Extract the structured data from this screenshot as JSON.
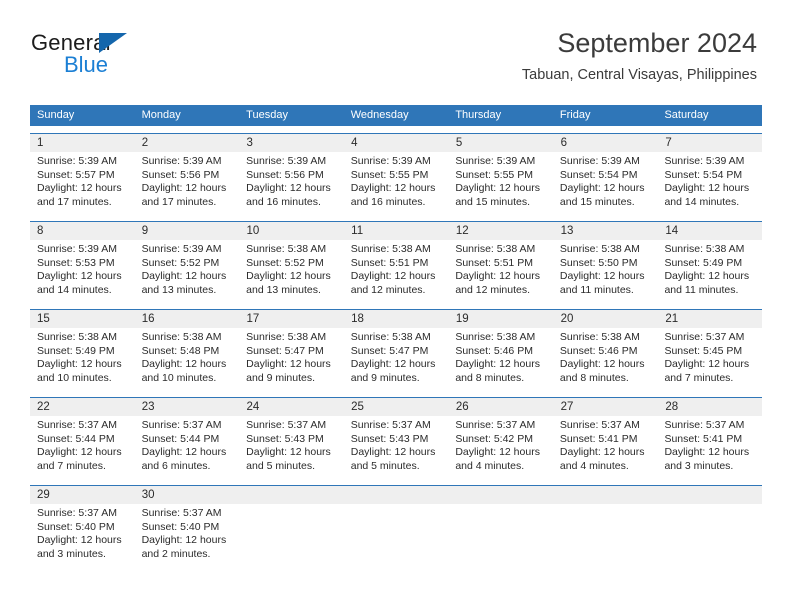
{
  "brand": {
    "name_dark": "General",
    "name_light": "Blue",
    "triangle_color": "#1466ac",
    "light_color": "#1b7fd4"
  },
  "header": {
    "title": "September 2024",
    "subtitle": "Tabuan, Central Visayas, Philippines"
  },
  "theme": {
    "header_bg": "#2f76b8",
    "row_border": "#2f76b8",
    "daynum_bg": "#efefef",
    "text": "#2b2b2b"
  },
  "weekdays": [
    "Sunday",
    "Monday",
    "Tuesday",
    "Wednesday",
    "Thursday",
    "Friday",
    "Saturday"
  ],
  "weeks": [
    {
      "days": [
        {
          "num": "1",
          "sunrise": "Sunrise: 5:39 AM",
          "sunset": "Sunset: 5:57 PM",
          "daylight1": "Daylight: 12 hours",
          "daylight2": "and 17 minutes."
        },
        {
          "num": "2",
          "sunrise": "Sunrise: 5:39 AM",
          "sunset": "Sunset: 5:56 PM",
          "daylight1": "Daylight: 12 hours",
          "daylight2": "and 17 minutes."
        },
        {
          "num": "3",
          "sunrise": "Sunrise: 5:39 AM",
          "sunset": "Sunset: 5:56 PM",
          "daylight1": "Daylight: 12 hours",
          "daylight2": "and 16 minutes."
        },
        {
          "num": "4",
          "sunrise": "Sunrise: 5:39 AM",
          "sunset": "Sunset: 5:55 PM",
          "daylight1": "Daylight: 12 hours",
          "daylight2": "and 16 minutes."
        },
        {
          "num": "5",
          "sunrise": "Sunrise: 5:39 AM",
          "sunset": "Sunset: 5:55 PM",
          "daylight1": "Daylight: 12 hours",
          "daylight2": "and 15 minutes."
        },
        {
          "num": "6",
          "sunrise": "Sunrise: 5:39 AM",
          "sunset": "Sunset: 5:54 PM",
          "daylight1": "Daylight: 12 hours",
          "daylight2": "and 15 minutes."
        },
        {
          "num": "7",
          "sunrise": "Sunrise: 5:39 AM",
          "sunset": "Sunset: 5:54 PM",
          "daylight1": "Daylight: 12 hours",
          "daylight2": "and 14 minutes."
        }
      ]
    },
    {
      "days": [
        {
          "num": "8",
          "sunrise": "Sunrise: 5:39 AM",
          "sunset": "Sunset: 5:53 PM",
          "daylight1": "Daylight: 12 hours",
          "daylight2": "and 14 minutes."
        },
        {
          "num": "9",
          "sunrise": "Sunrise: 5:39 AM",
          "sunset": "Sunset: 5:52 PM",
          "daylight1": "Daylight: 12 hours",
          "daylight2": "and 13 minutes."
        },
        {
          "num": "10",
          "sunrise": "Sunrise: 5:38 AM",
          "sunset": "Sunset: 5:52 PM",
          "daylight1": "Daylight: 12 hours",
          "daylight2": "and 13 minutes."
        },
        {
          "num": "11",
          "sunrise": "Sunrise: 5:38 AM",
          "sunset": "Sunset: 5:51 PM",
          "daylight1": "Daylight: 12 hours",
          "daylight2": "and 12 minutes."
        },
        {
          "num": "12",
          "sunrise": "Sunrise: 5:38 AM",
          "sunset": "Sunset: 5:51 PM",
          "daylight1": "Daylight: 12 hours",
          "daylight2": "and 12 minutes."
        },
        {
          "num": "13",
          "sunrise": "Sunrise: 5:38 AM",
          "sunset": "Sunset: 5:50 PM",
          "daylight1": "Daylight: 12 hours",
          "daylight2": "and 11 minutes."
        },
        {
          "num": "14",
          "sunrise": "Sunrise: 5:38 AM",
          "sunset": "Sunset: 5:49 PM",
          "daylight1": "Daylight: 12 hours",
          "daylight2": "and 11 minutes."
        }
      ]
    },
    {
      "days": [
        {
          "num": "15",
          "sunrise": "Sunrise: 5:38 AM",
          "sunset": "Sunset: 5:49 PM",
          "daylight1": "Daylight: 12 hours",
          "daylight2": "and 10 minutes."
        },
        {
          "num": "16",
          "sunrise": "Sunrise: 5:38 AM",
          "sunset": "Sunset: 5:48 PM",
          "daylight1": "Daylight: 12 hours",
          "daylight2": "and 10 minutes."
        },
        {
          "num": "17",
          "sunrise": "Sunrise: 5:38 AM",
          "sunset": "Sunset: 5:47 PM",
          "daylight1": "Daylight: 12 hours",
          "daylight2": "and 9 minutes."
        },
        {
          "num": "18",
          "sunrise": "Sunrise: 5:38 AM",
          "sunset": "Sunset: 5:47 PM",
          "daylight1": "Daylight: 12 hours",
          "daylight2": "and 9 minutes."
        },
        {
          "num": "19",
          "sunrise": "Sunrise: 5:38 AM",
          "sunset": "Sunset: 5:46 PM",
          "daylight1": "Daylight: 12 hours",
          "daylight2": "and 8 minutes."
        },
        {
          "num": "20",
          "sunrise": "Sunrise: 5:38 AM",
          "sunset": "Sunset: 5:46 PM",
          "daylight1": "Daylight: 12 hours",
          "daylight2": "and 8 minutes."
        },
        {
          "num": "21",
          "sunrise": "Sunrise: 5:37 AM",
          "sunset": "Sunset: 5:45 PM",
          "daylight1": "Daylight: 12 hours",
          "daylight2": "and 7 minutes."
        }
      ]
    },
    {
      "days": [
        {
          "num": "22",
          "sunrise": "Sunrise: 5:37 AM",
          "sunset": "Sunset: 5:44 PM",
          "daylight1": "Daylight: 12 hours",
          "daylight2": "and 7 minutes."
        },
        {
          "num": "23",
          "sunrise": "Sunrise: 5:37 AM",
          "sunset": "Sunset: 5:44 PM",
          "daylight1": "Daylight: 12 hours",
          "daylight2": "and 6 minutes."
        },
        {
          "num": "24",
          "sunrise": "Sunrise: 5:37 AM",
          "sunset": "Sunset: 5:43 PM",
          "daylight1": "Daylight: 12 hours",
          "daylight2": "and 5 minutes."
        },
        {
          "num": "25",
          "sunrise": "Sunrise: 5:37 AM",
          "sunset": "Sunset: 5:43 PM",
          "daylight1": "Daylight: 12 hours",
          "daylight2": "and 5 minutes."
        },
        {
          "num": "26",
          "sunrise": "Sunrise: 5:37 AM",
          "sunset": "Sunset: 5:42 PM",
          "daylight1": "Daylight: 12 hours",
          "daylight2": "and 4 minutes."
        },
        {
          "num": "27",
          "sunrise": "Sunrise: 5:37 AM",
          "sunset": "Sunset: 5:41 PM",
          "daylight1": "Daylight: 12 hours",
          "daylight2": "and 4 minutes."
        },
        {
          "num": "28",
          "sunrise": "Sunrise: 5:37 AM",
          "sunset": "Sunset: 5:41 PM",
          "daylight1": "Daylight: 12 hours",
          "daylight2": "and 3 minutes."
        }
      ]
    },
    {
      "days": [
        {
          "num": "29",
          "sunrise": "Sunrise: 5:37 AM",
          "sunset": "Sunset: 5:40 PM",
          "daylight1": "Daylight: 12 hours",
          "daylight2": "and 3 minutes."
        },
        {
          "num": "30",
          "sunrise": "Sunrise: 5:37 AM",
          "sunset": "Sunset: 5:40 PM",
          "daylight1": "Daylight: 12 hours",
          "daylight2": "and 2 minutes."
        },
        {
          "num": "",
          "sunrise": "",
          "sunset": "",
          "daylight1": "",
          "daylight2": ""
        },
        {
          "num": "",
          "sunrise": "",
          "sunset": "",
          "daylight1": "",
          "daylight2": ""
        },
        {
          "num": "",
          "sunrise": "",
          "sunset": "",
          "daylight1": "",
          "daylight2": ""
        },
        {
          "num": "",
          "sunrise": "",
          "sunset": "",
          "daylight1": "",
          "daylight2": ""
        },
        {
          "num": "",
          "sunrise": "",
          "sunset": "",
          "daylight1": "",
          "daylight2": ""
        }
      ]
    }
  ]
}
